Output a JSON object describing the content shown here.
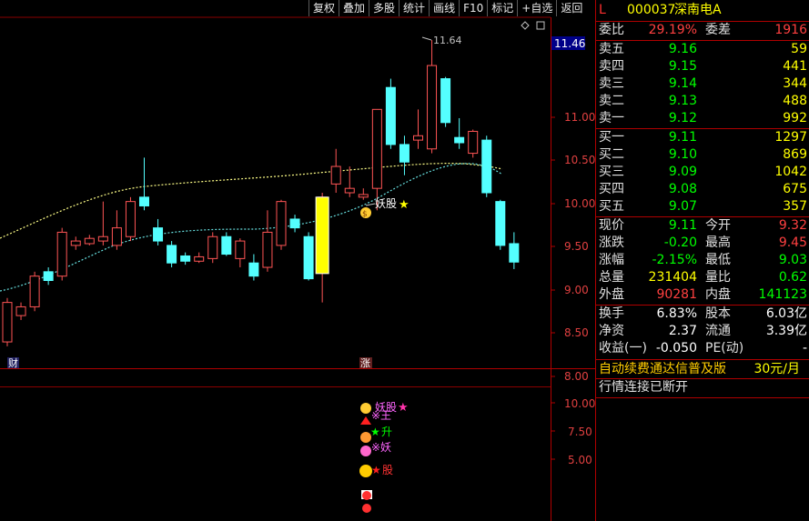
{
  "toolbar": {
    "buttons": [
      "复权",
      "叠加",
      "多股",
      "统计",
      "画线",
      "F10",
      "标记",
      "+自选",
      "返回"
    ]
  },
  "stock": {
    "flag": "L",
    "code": "000037",
    "name": "深南电A"
  },
  "ratio": {
    "label": "委比",
    "value": "29.19%",
    "label2": "委差",
    "value2": "1916"
  },
  "asks": [
    {
      "label": "卖五",
      "price": "9.16",
      "vol": "59"
    },
    {
      "label": "卖四",
      "price": "9.15",
      "vol": "441"
    },
    {
      "label": "卖三",
      "price": "9.14",
      "vol": "344"
    },
    {
      "label": "卖二",
      "price": "9.13",
      "vol": "488"
    },
    {
      "label": "卖一",
      "price": "9.12",
      "vol": "992"
    }
  ],
  "bids": [
    {
      "label": "买一",
      "price": "9.11",
      "vol": "1297"
    },
    {
      "label": "买二",
      "price": "9.10",
      "vol": "869"
    },
    {
      "label": "买三",
      "price": "9.09",
      "vol": "1042"
    },
    {
      "label": "买四",
      "price": "9.08",
      "vol": "675"
    },
    {
      "label": "买五",
      "price": "9.07",
      "vol": "357"
    }
  ],
  "quote": [
    {
      "l1": "现价",
      "v1": "9.11",
      "c1": "green",
      "l2": "今开",
      "v2": "9.32",
      "c2": "red"
    },
    {
      "l1": "涨跌",
      "v1": "-0.20",
      "c1": "green",
      "l2": "最高",
      "v2": "9.45",
      "c2": "red"
    },
    {
      "l1": "涨幅",
      "v1": "-2.15%",
      "c1": "green",
      "l2": "最低",
      "v2": "9.03",
      "c2": "green"
    },
    {
      "l1": "总量",
      "v1": "231404",
      "c1": "yellow",
      "l2": "量比",
      "v2": "0.62",
      "c2": "green"
    },
    {
      "l1": "外盘",
      "v1": "90281",
      "c1": "red",
      "l2": "内盘",
      "v2": "141123",
      "c2": "green"
    }
  ],
  "fund": [
    {
      "l1": "换手",
      "v1": "6.83%",
      "l2": "股本",
      "v2": "6.03亿"
    },
    {
      "l1": "净资",
      "v1": "2.37",
      "l2": "流通",
      "v2": "3.39亿"
    },
    {
      "l1": "收益(一)",
      "v1": "-0.050",
      "l2": "PE(动)",
      "v2": "-"
    }
  ],
  "ad": {
    "text": "自动续费通达信普及版",
    "price": "30元/月"
  },
  "status": {
    "text": "行情连接已断开"
  },
  "chart": {
    "price_ticks": [
      "11.00",
      "10.50",
      "10.00",
      "9.50",
      "9.00",
      "8.50",
      "8.00"
    ],
    "current_price_tag": "11.46",
    "high_label": "11.64",
    "event_marker_left": "财",
    "event_marker_mid": "涨",
    "signal_label": "妖股",
    "indicator_ticks": [
      "10.00",
      "7.50",
      "5.00"
    ],
    "indicator_labels": {
      "a": "妖股",
      "b": "※王",
      "c": "升",
      "d": "※妖",
      "e": "股"
    },
    "colors": {
      "up": "#ff5555",
      "down": "#54ffff",
      "ma_short": "#ffff88",
      "ma_long": "#66dddd",
      "highlight": "#ffff00"
    }
  },
  "chart_data": {
    "type": "candlestick",
    "ylim": [
      7.9,
      11.9
    ],
    "candles": [
      {
        "o": 8.2,
        "c": 8.65,
        "h": 8.7,
        "l": 8.15
      },
      {
        "o": 8.5,
        "c": 8.6,
        "h": 8.65,
        "l": 8.45
      },
      {
        "o": 8.6,
        "c": 8.95,
        "h": 9.0,
        "l": 8.55
      },
      {
        "o": 9.0,
        "c": 8.9,
        "h": 9.05,
        "l": 8.85
      },
      {
        "o": 8.95,
        "c": 9.45,
        "h": 9.5,
        "l": 8.9
      },
      {
        "o": 9.3,
        "c": 9.35,
        "h": 9.4,
        "l": 9.25
      },
      {
        "o": 9.32,
        "c": 9.38,
        "h": 9.42,
        "l": 9.3
      },
      {
        "o": 9.35,
        "c": 9.4,
        "h": 9.8,
        "l": 9.3
      },
      {
        "o": 9.3,
        "c": 9.5,
        "h": 9.7,
        "l": 9.25
      },
      {
        "o": 9.4,
        "c": 9.8,
        "h": 9.85,
        "l": 9.35
      },
      {
        "o": 9.85,
        "c": 9.75,
        "h": 10.3,
        "l": 9.7
      },
      {
        "o": 9.5,
        "c": 9.35,
        "h": 9.6,
        "l": 9.3
      },
      {
        "o": 9.3,
        "c": 9.1,
        "h": 9.35,
        "l": 9.05
      },
      {
        "o": 9.18,
        "c": 9.12,
        "h": 9.22,
        "l": 9.08
      },
      {
        "o": 9.12,
        "c": 9.17,
        "h": 9.22,
        "l": 9.1
      },
      {
        "o": 9.15,
        "c": 9.4,
        "h": 9.45,
        "l": 9.1
      },
      {
        "o": 9.4,
        "c": 9.2,
        "h": 9.45,
        "l": 9.18
      },
      {
        "o": 9.15,
        "c": 9.35,
        "h": 9.38,
        "l": 9.05
      },
      {
        "o": 9.1,
        "c": 8.95,
        "h": 9.2,
        "l": 8.9
      },
      {
        "o": 9.05,
        "c": 9.45,
        "h": 9.7,
        "l": 9.0
      },
      {
        "o": 9.3,
        "c": 9.8,
        "h": 9.82,
        "l": 9.25
      },
      {
        "o": 9.6,
        "c": 9.5,
        "h": 9.65,
        "l": 9.45
      },
      {
        "o": 9.4,
        "c": 8.92,
        "h": 9.45,
        "l": 8.9
      },
      {
        "o": 9.0,
        "c": 9.85,
        "h": 9.9,
        "l": 8.65
      },
      {
        "o": 10.0,
        "c": 10.2,
        "h": 10.4,
        "l": 9.9
      },
      {
        "o": 9.9,
        "c": 9.95,
        "h": 10.2,
        "l": 9.85
      },
      {
        "o": 9.85,
        "c": 9.88,
        "h": 9.95,
        "l": 9.82
      },
      {
        "o": 9.95,
        "c": 10.85,
        "h": 10.85,
        "l": 9.7
      },
      {
        "o": 11.1,
        "c": 10.45,
        "h": 11.2,
        "l": 10.4
      },
      {
        "o": 10.45,
        "c": 10.25,
        "h": 10.55,
        "l": 10.1
      },
      {
        "o": 10.5,
        "c": 10.55,
        "h": 10.85,
        "l": 10.4
      },
      {
        "o": 10.4,
        "c": 11.35,
        "h": 11.64,
        "l": 10.35
      },
      {
        "o": 11.2,
        "c": 10.7,
        "h": 11.22,
        "l": 10.65
      },
      {
        "o": 10.53,
        "c": 10.47,
        "h": 10.75,
        "l": 10.4
      },
      {
        "o": 10.35,
        "c": 10.6,
        "h": 10.62,
        "l": 10.3
      },
      {
        "o": 10.5,
        "c": 9.9,
        "h": 10.55,
        "l": 9.85
      },
      {
        "o": 9.8,
        "c": 9.3,
        "h": 9.82,
        "l": 9.25
      },
      {
        "o": 9.32,
        "c": 9.11,
        "h": 9.45,
        "l": 9.03
      }
    ]
  }
}
